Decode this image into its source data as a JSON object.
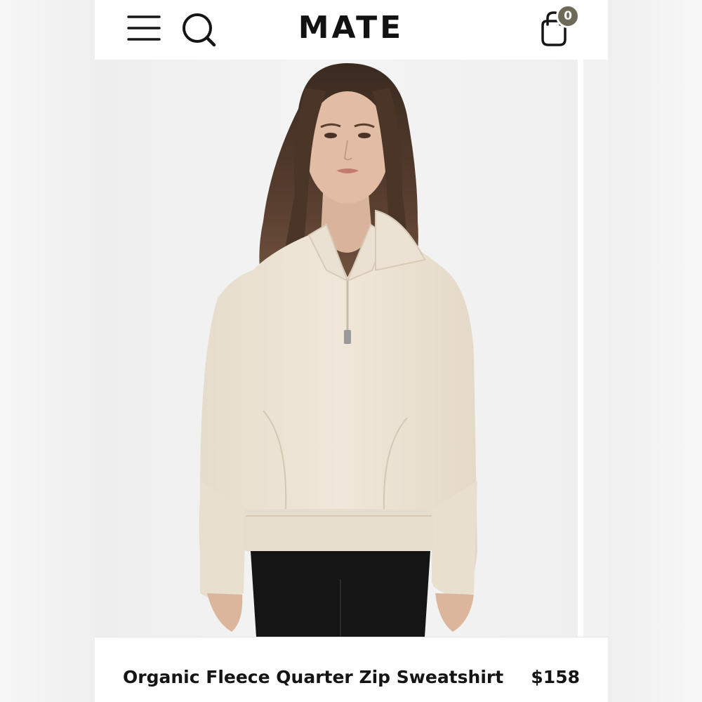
{
  "header": {
    "menu_icon": "hamburger-menu-icon",
    "search_icon": "search-icon",
    "logo": "MATE",
    "cart_icon": "shopping-bag-icon",
    "cart_count": "0"
  },
  "product": {
    "image": "Model wearing cream quarter zip sweatshirt with black pants",
    "name": "Organic Fleece Quarter Zip Sweatshirt",
    "price": "$158"
  },
  "colors": {
    "badge": "#6d6a58",
    "sweatshirt": "#ece3d4",
    "text": "#151515"
  }
}
